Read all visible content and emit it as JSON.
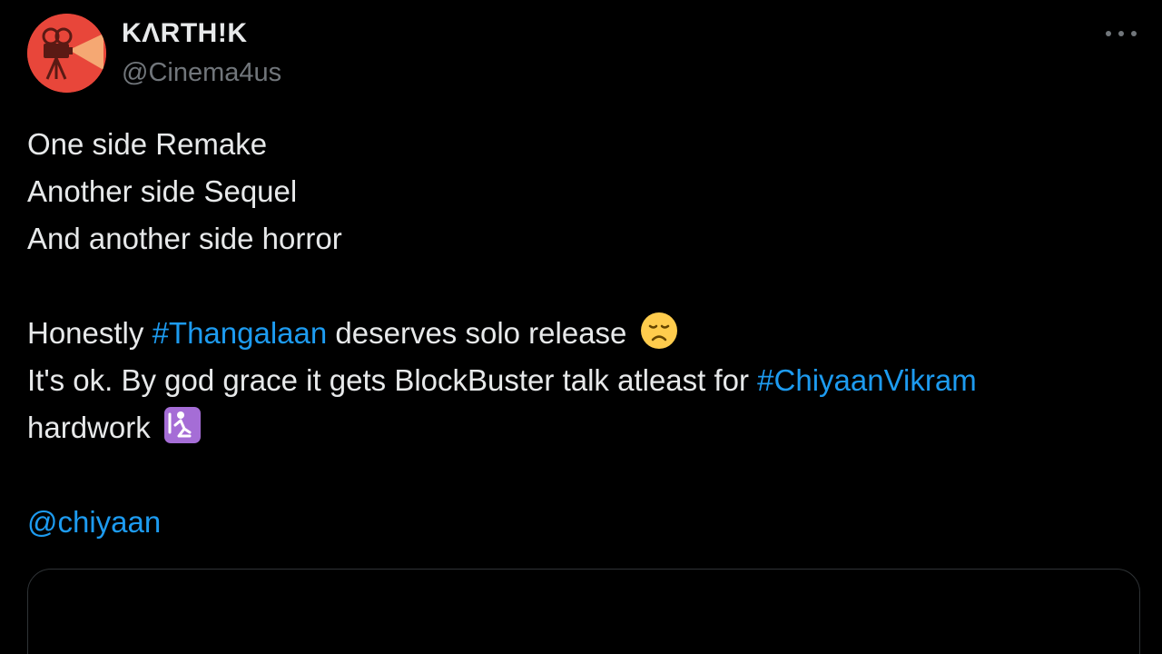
{
  "author": {
    "display_name": "KΛRTH!K",
    "handle": "@Cinema4us",
    "avatar_icon": "movie-camera-icon",
    "avatar_color": "#e8463a"
  },
  "more_icon": "more-horizontal-icon",
  "tweet": {
    "line1": "One side Remake",
    "line2": "Another side Sequel",
    "line3": "And another side horror",
    "line4_prefix": "Honestly ",
    "hashtag1": "#Thangalaan",
    "line4_suffix": " deserves solo release",
    "emoji1": "disappointed-face-emoji",
    "line5_prefix": "It's ok. By god grace it gets BlockBuster talk atleast for ",
    "hashtag2": "#ChiyaanVikram",
    "line6_prefix": "hardwork ",
    "emoji2": "person-kneeling-emoji",
    "mention": "@chiyaan"
  },
  "colors": {
    "background": "#000000",
    "text": "#e7e9ea",
    "secondary": "#71767b",
    "link": "#1d9bf0",
    "border": "#2f3336"
  }
}
